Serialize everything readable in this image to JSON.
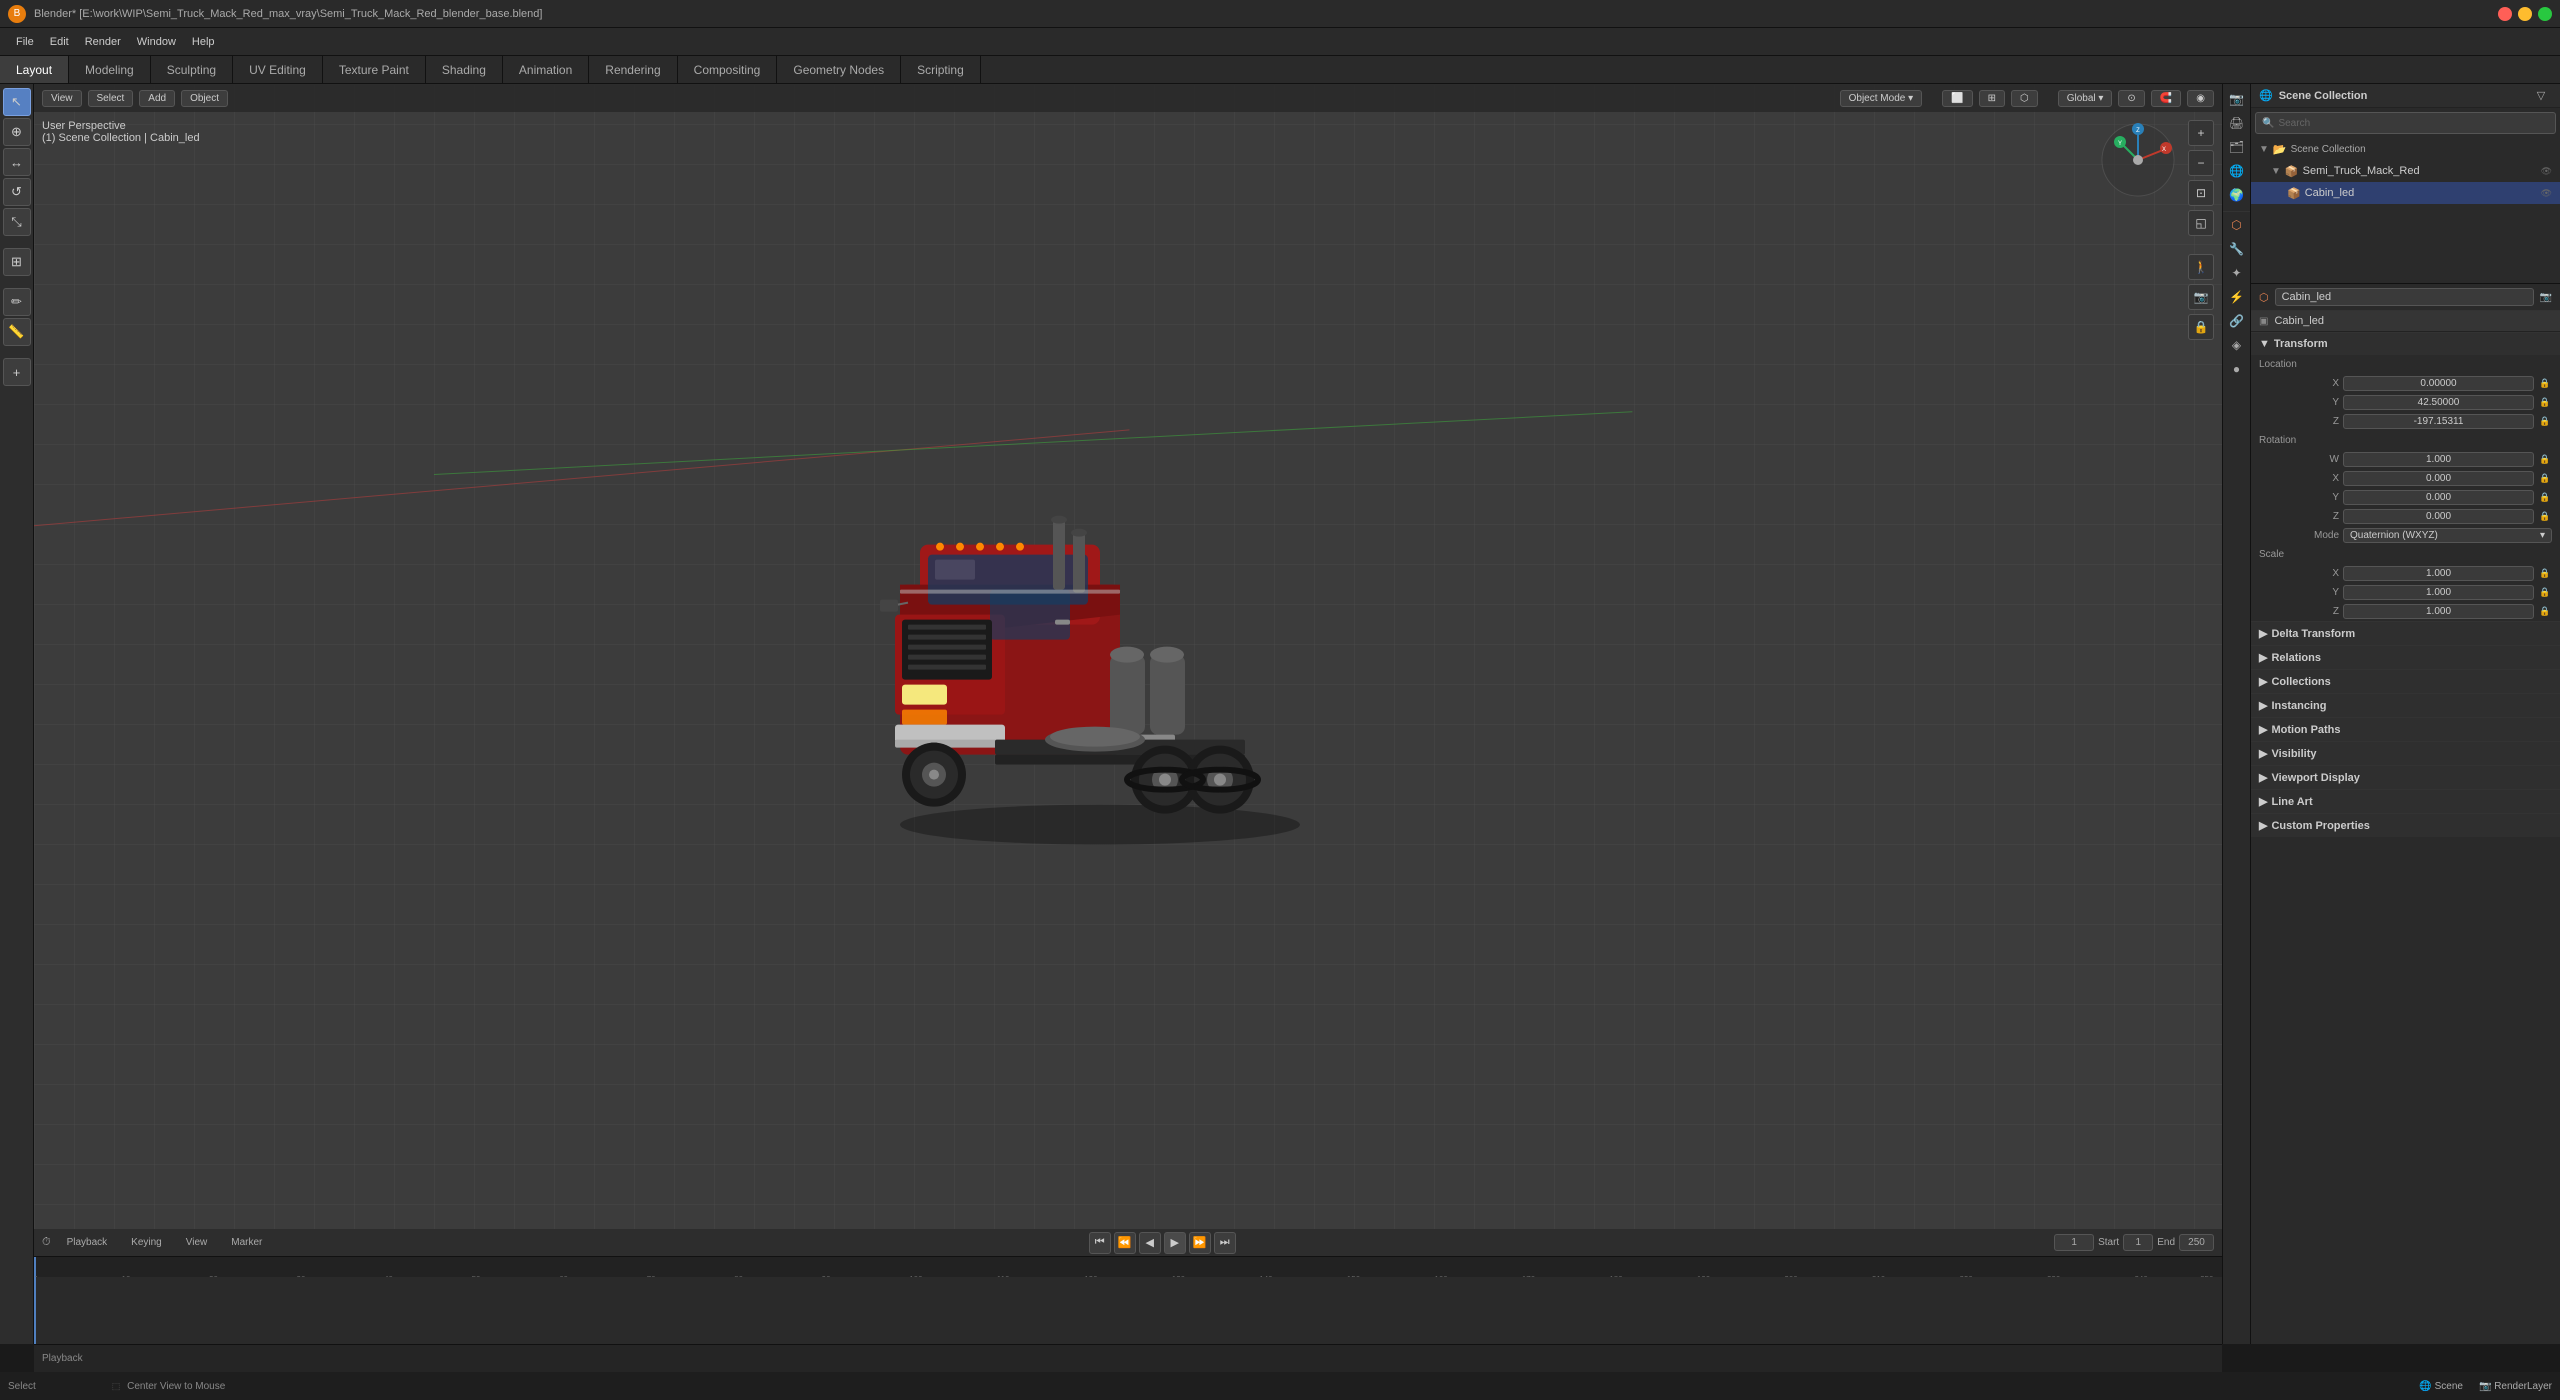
{
  "titleBar": {
    "title": "Blender* [E:\\work\\WIP\\Semi_Truck_Mack_Red_max_vray\\Semi_Truck_Mack_Red_blender_base.blend]",
    "appIcon": "B"
  },
  "menuBar": {
    "items": [
      "File",
      "Edit",
      "Render",
      "Window",
      "Help"
    ]
  },
  "tabs": [
    {
      "label": "Layout",
      "active": true
    },
    {
      "label": "Modeling"
    },
    {
      "label": "Sculpting"
    },
    {
      "label": "UV Editing"
    },
    {
      "label": "Texture Paint"
    },
    {
      "label": "Shading"
    },
    {
      "label": "Animation"
    },
    {
      "label": "Rendering"
    },
    {
      "label": "Compositing"
    },
    {
      "label": "Geometry Nodes"
    },
    {
      "label": "Scripting"
    }
  ],
  "viewport": {
    "mode": "Object Mode",
    "view": "User Perspective",
    "collection": "(1) Scene Collection | Cabin_led",
    "global": "Global",
    "buttons": [
      "View",
      "Select",
      "Add",
      "Object"
    ]
  },
  "leftTools": [
    {
      "icon": "↖",
      "name": "select-tool",
      "active": true
    },
    {
      "icon": "⊕",
      "name": "cursor-tool"
    },
    {
      "icon": "↔",
      "name": "move-tool"
    },
    {
      "icon": "↺",
      "name": "rotate-tool"
    },
    {
      "icon": "⤡",
      "name": "scale-tool"
    },
    {
      "icon": "⬡",
      "name": "transform-tool"
    },
    {
      "icon": "✏",
      "name": "annotate-tool"
    },
    {
      "icon": "◉",
      "name": "measure-tool"
    },
    {
      "icon": "▣",
      "name": "snap-tool"
    },
    {
      "icon": "⊞",
      "name": "add-tool"
    }
  ],
  "sceneCollection": {
    "title": "Scene Collection",
    "searchPlaceholder": "Search",
    "items": [
      {
        "name": "Semi_Truck_Mack_Red",
        "icon": "📦",
        "level": 1
      },
      {
        "name": "Cabin_led",
        "icon": "📦",
        "level": 2,
        "selected": true
      }
    ]
  },
  "properties": {
    "objectName": "Cabin_led",
    "collectionName": "Cabin_led",
    "transform": {
      "label": "Transform",
      "location": {
        "x": "0.00000",
        "y": "42.50000",
        "z": "-197.15311"
      },
      "rotation": {
        "w": "1.000",
        "x": "0.000",
        "y": "0.000",
        "z": "0.000"
      },
      "mode": "Quaternion (WXYZ)",
      "scale": {
        "x": "1.000",
        "y": "1.000",
        "z": "1.000"
      }
    },
    "sections": [
      {
        "label": "Delta Transform",
        "collapsed": true
      },
      {
        "label": "Relations",
        "collapsed": true
      },
      {
        "label": "Collections",
        "collapsed": true
      },
      {
        "label": "Instancing",
        "collapsed": true
      },
      {
        "label": "Motion Paths",
        "collapsed": true
      },
      {
        "label": "Visibility",
        "collapsed": true
      },
      {
        "label": "Viewport Display",
        "collapsed": true
      },
      {
        "label": "Line Art",
        "collapsed": true
      },
      {
        "label": "Custom Properties",
        "collapsed": true
      }
    ]
  },
  "timeline": {
    "label": "Playback",
    "menuItems": [
      "Playback",
      "Keying",
      "View",
      "Marker"
    ],
    "frameStart": "1",
    "frameEnd": "250",
    "currentFrame": "1",
    "startLabel": "Start",
    "endLabel": "End",
    "startValue": "1",
    "endValue": "250",
    "rulerMarks": [
      1,
      10,
      20,
      30,
      40,
      50,
      60,
      70,
      80,
      90,
      100,
      110,
      120,
      130,
      140,
      150,
      160,
      170,
      180,
      190,
      200,
      210,
      220,
      230,
      240,
      250
    ]
  },
  "statusBar": {
    "leftText": "Select",
    "centerText": "Center View to Mouse",
    "renderLayer": "RenderLayer",
    "scene": "Scene"
  },
  "rightIconStrip": [
    {
      "icon": "📷",
      "name": "render-properties",
      "active": false
    },
    {
      "icon": "🎞",
      "name": "output-properties"
    },
    {
      "icon": "🖼",
      "name": "view-layer-properties"
    },
    {
      "icon": "🌐",
      "name": "scene-properties"
    },
    {
      "icon": "🌍",
      "name": "world-properties"
    },
    {
      "icon": "⬡",
      "name": "object-properties",
      "active": true
    },
    {
      "icon": "🔧",
      "name": "modifier-properties"
    },
    {
      "icon": "◈",
      "name": "particles-properties"
    },
    {
      "icon": "⚡",
      "name": "physics-properties"
    },
    {
      "icon": "🔗",
      "name": "constraints-properties"
    },
    {
      "icon": "📊",
      "name": "data-properties"
    }
  ],
  "colors": {
    "accent": "#5680c2",
    "orange": "#e87d0d",
    "selected": "#2f4070",
    "bg_dark": "#2a2a2a",
    "bg_medium": "#3a3a3a",
    "text_normal": "#cccccc",
    "text_dim": "#999999"
  }
}
